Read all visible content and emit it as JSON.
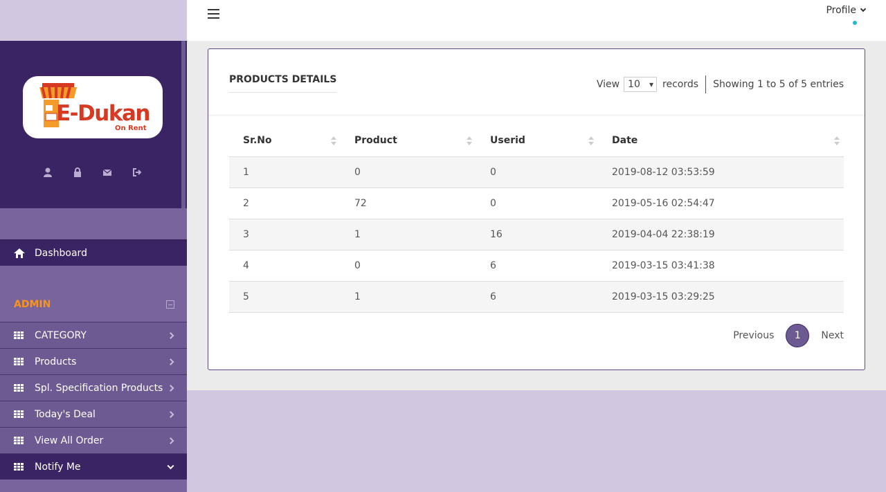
{
  "header": {
    "profile_label": "Profile"
  },
  "brand": {
    "logo_text": "E-Dukan",
    "logo_sub": "On Rent"
  },
  "sidebar": {
    "dashboard_label": "Dashboard",
    "section_label": "ADMIN",
    "items": [
      {
        "label": "CATEGORY"
      },
      {
        "label": "Products"
      },
      {
        "label": "Spl. Specification Products"
      },
      {
        "label": "Today's Deal"
      },
      {
        "label": "View All Order"
      },
      {
        "label": "Notify Me"
      }
    ]
  },
  "card": {
    "title": "PRODUCTS DETAILS",
    "view_label": "View",
    "page_size": "10",
    "records_label": "records",
    "showing_text": "Showing 1 to 5 of 5 entries"
  },
  "table": {
    "columns": [
      "Sr.No",
      "Product",
      "Userid",
      "Date"
    ],
    "rows": [
      [
        "1",
        "0",
        "0",
        "2019-08-12 03:53:59"
      ],
      [
        "2",
        "72",
        "0",
        "2019-05-16 02:54:47"
      ],
      [
        "3",
        "1",
        "16",
        "2019-04-04 22:38:19"
      ],
      [
        "4",
        "0",
        "6",
        "2019-03-15 03:41:38"
      ],
      [
        "5",
        "1",
        "6",
        "2019-03-15 03:29:25"
      ]
    ]
  },
  "pager": {
    "prev_label": "Previous",
    "current_page": "1",
    "next_label": "Next"
  },
  "colors": {
    "sidebar_dark": "#3b2463",
    "sidebar_mid": "#6e5a92",
    "accent_orange": "#f7941d",
    "online_dot": "#23b7d2"
  }
}
